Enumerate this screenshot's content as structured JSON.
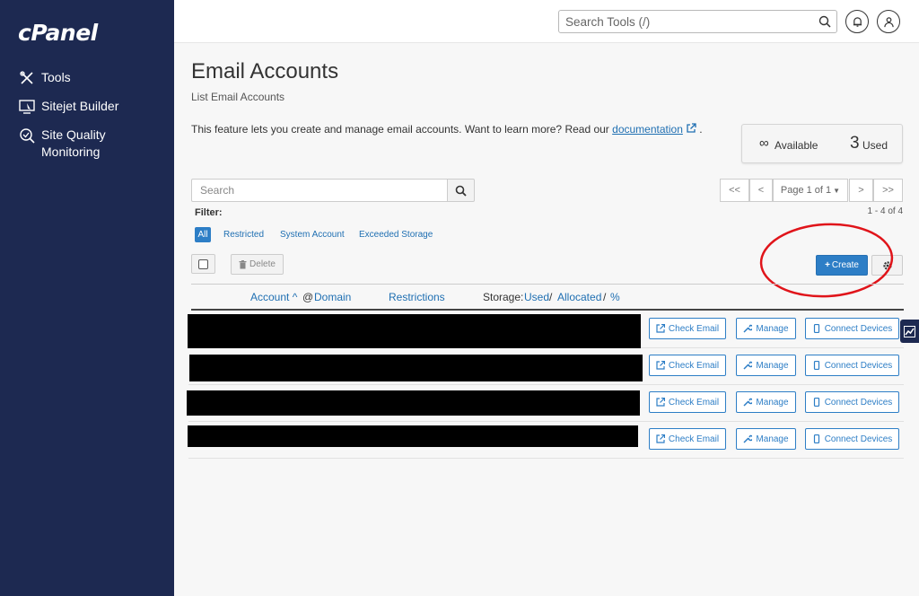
{
  "sidebar": {
    "logo": "cPanel",
    "items": [
      {
        "label": "Tools",
        "icon": "tools-icon"
      },
      {
        "label": "Sitejet Builder",
        "icon": "sitejet-icon"
      },
      {
        "label": "Site Quality Monitoring",
        "icon": "site-quality-icon"
      }
    ]
  },
  "topbar": {
    "search_placeholder": "Search Tools (/)"
  },
  "page": {
    "title": "Email Accounts",
    "subtitle": "List Email Accounts",
    "description": "This feature lets you create and manage email accounts. Want to learn more? Read our ",
    "doc_link": "documentation",
    "desc_suffix": "."
  },
  "usage": {
    "infinity": "∞",
    "available_label": "Available",
    "used_count": "3",
    "used_label": "Used"
  },
  "search": {
    "placeholder": "Search"
  },
  "pagination": {
    "first": "<<",
    "prev": "<",
    "page_label": "Page 1 of 1",
    "next": ">",
    "last": ">>",
    "count": "1 - 4 of 4"
  },
  "filter": {
    "label": "Filter:",
    "options": [
      "All",
      "Restricted",
      "System Account",
      "Exceeded Storage"
    ],
    "selected": "All"
  },
  "toolbar": {
    "delete_label": "Delete",
    "create_label": "Create"
  },
  "table": {
    "col_account": "Account",
    "col_at": "@",
    "col_domain": "Domain",
    "col_restrictions": "Restrictions",
    "col_storage": "Storage:",
    "col_used": "Used",
    "col_sep": "/",
    "col_allocated": "Allocated",
    "col_percent": "%",
    "rows": [
      {
        "check_email": "Check Email",
        "manage": "Manage",
        "connect": "Connect Devices"
      },
      {
        "check_email": "Check Email",
        "manage": "Manage",
        "connect": "Connect Devices"
      },
      {
        "check_email": "Check Email",
        "manage": "Manage",
        "connect": "Connect Devices"
      },
      {
        "check_email": "Check Email",
        "manage": "Manage",
        "connect": "Connect Devices"
      }
    ]
  },
  "colors": {
    "sidebar_bg": "#1d2951",
    "accent": "#2d7ec6",
    "annotation": "#e0141a"
  }
}
